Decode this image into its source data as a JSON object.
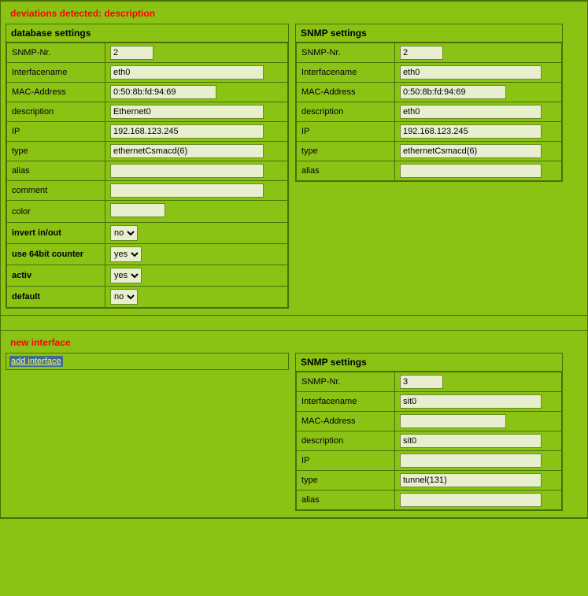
{
  "section1": {
    "title": "deviations detected: description",
    "db": {
      "heading": "database settings",
      "rows": {
        "snmpnr_label": "SNMP-Nr.",
        "snmpnr": "2",
        "ifname_label": "Interfacename",
        "ifname": "eth0",
        "mac_label": "MAC-Address",
        "mac": "0:50:8b:fd:94:69",
        "desc_label": "description",
        "desc": "Ethernet0",
        "ip_label": "IP",
        "ip": "192.168.123.245",
        "type_label": "type",
        "type": "ethernetCsmacd(6)",
        "alias_label": "alias",
        "alias": "",
        "comment_label": "comment",
        "comment": "",
        "color_label": "color",
        "invert_label": "invert in/out",
        "invert": "no",
        "use64_label": "use 64bit counter",
        "use64": "yes",
        "activ_label": "activ",
        "activ": "yes",
        "default_label": "default",
        "default": "no"
      }
    },
    "snmp": {
      "heading": "SNMP settings",
      "rows": {
        "snmpnr_label": "SNMP-Nr.",
        "snmpnr": "2",
        "ifname_label": "Interfacename",
        "ifname": "eth0",
        "mac_label": "MAC-Address",
        "mac": "0:50:8b:fd:94:69",
        "desc_label": "description",
        "desc": "eth0",
        "ip_label": "IP",
        "ip": "192.168.123.245",
        "type_label": "type",
        "type": "ethernetCsmacd(6)",
        "alias_label": "alias",
        "alias": ""
      }
    }
  },
  "section2": {
    "title": "new interface",
    "addlink": "add interface",
    "snmp": {
      "heading": "SNMP settings",
      "rows": {
        "snmpnr_label": "SNMP-Nr.",
        "snmpnr": "3",
        "ifname_label": "Interfacename",
        "ifname": "sit0",
        "mac_label": "MAC-Address",
        "mac": "",
        "desc_label": "description",
        "desc": "sit0",
        "ip_label": "IP",
        "ip": "",
        "type_label": "type",
        "type": "tunnel(131)",
        "alias_label": "alias",
        "alias": ""
      }
    }
  },
  "opts": {
    "yesno": [
      "yes",
      "no"
    ]
  }
}
